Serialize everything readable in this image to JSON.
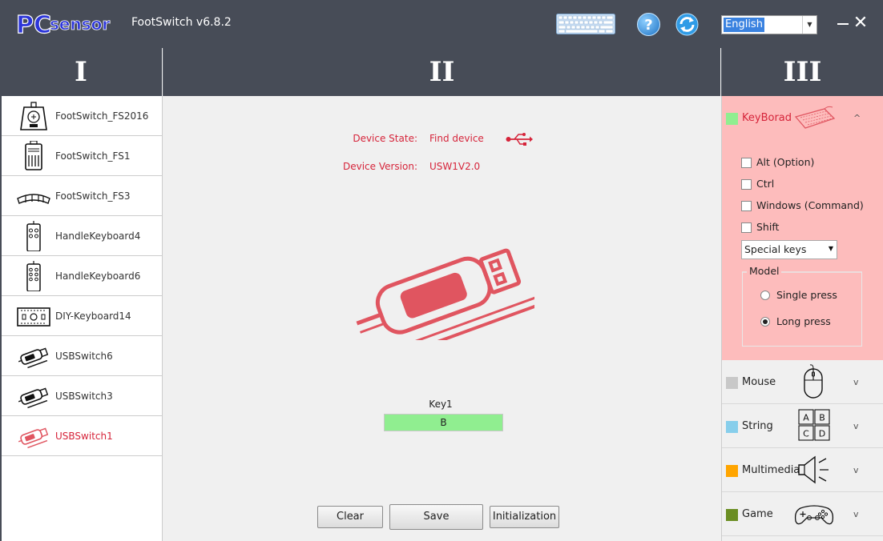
{
  "titlebar": {
    "logo_text": "PCsensor",
    "app_title": "FootSwitch v6.8.2",
    "help_glyph": "?",
    "language": "English",
    "close_glyph": "✕"
  },
  "columns": {
    "left": "I",
    "center": "II",
    "right": "III"
  },
  "devices": [
    {
      "label": "FootSwitch_FS2016",
      "icon": "footswitch-fs2016-icon",
      "active": false
    },
    {
      "label": "FootSwitch_FS1",
      "icon": "footswitch-fs1-icon",
      "active": false
    },
    {
      "label": "FootSwitch_FS3",
      "icon": "footswitch-fs3-icon",
      "active": false
    },
    {
      "label": "HandleKeyboard4",
      "icon": "handle-keyboard4-icon",
      "active": false
    },
    {
      "label": "HandleKeyboard6",
      "icon": "handle-keyboard6-icon",
      "active": false
    },
    {
      "label": "DIY-Keyboard14",
      "icon": "diy-keyboard14-icon",
      "active": false
    },
    {
      "label": "USBSwitch6",
      "icon": "usb-switch6-icon",
      "active": false
    },
    {
      "label": "USBSwitch3",
      "icon": "usb-switch3-icon",
      "active": false
    },
    {
      "label": "USBSwitch1",
      "icon": "usb-switch1-icon",
      "active": true
    }
  ],
  "device_info": {
    "state_label": "Device State:",
    "state_value": "Find device",
    "version_label": "Device Version:",
    "version_value": "USW1V2.0"
  },
  "key": {
    "label": "Key1",
    "value": "B"
  },
  "buttons": {
    "clear": "Clear",
    "save": "Save",
    "init": "Initialization"
  },
  "categories": {
    "keyboard": {
      "label": "KeyBorad",
      "color": "#90ee90",
      "chevron": "^"
    },
    "mouse": {
      "label": "Mouse",
      "color": "#c8c8c8",
      "chevron": "v"
    },
    "string": {
      "label": "String",
      "color": "#87ceeb",
      "chevron": "v",
      "keys": [
        "A",
        "B",
        "C",
        "D"
      ]
    },
    "multimedia": {
      "label": "Multimedia",
      "color": "#ffa500",
      "chevron": "v"
    },
    "game": {
      "label": "Game",
      "color": "#6b8e23",
      "chevron": "v"
    }
  },
  "modifiers": [
    "Alt (Option)",
    "Ctrl",
    "Windows (Command)",
    "Shift"
  ],
  "special_keys": "Special keys",
  "model": {
    "legend": "Model",
    "single": "Single press",
    "long": "Long press",
    "selected": "long"
  }
}
